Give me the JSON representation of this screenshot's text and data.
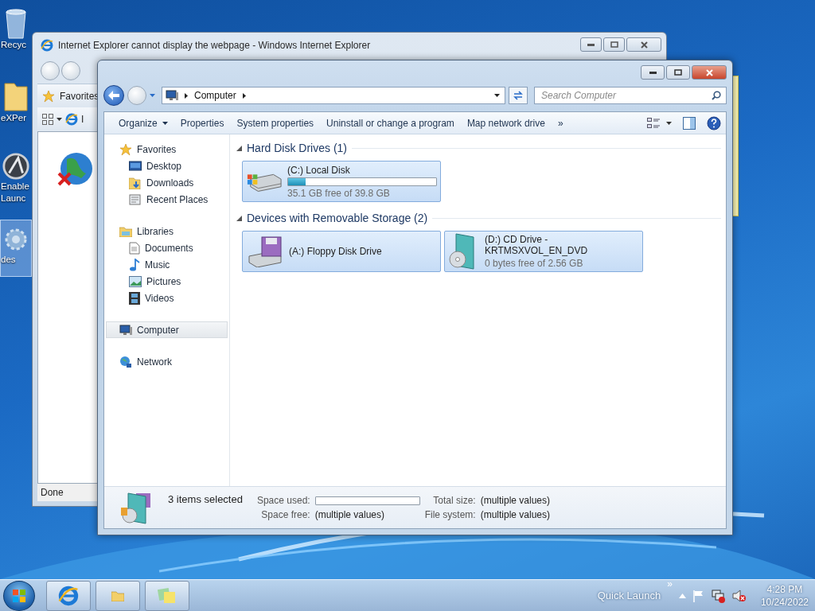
{
  "desktop_icons": [
    {
      "label": "Recyc",
      "selected": false
    },
    {
      "label": "eXPer",
      "selected": false
    },
    {
      "label": "Enable Launc",
      "selected": false
    },
    {
      "label": "des",
      "selected": true
    }
  ],
  "ie_window": {
    "title": "Internet Explorer cannot display the webpage - Windows Internet Explorer",
    "favorites": "Favorites",
    "tab": "I",
    "status": "Done"
  },
  "explorer": {
    "address": {
      "crumbs": [
        "Computer"
      ]
    },
    "search": {
      "placeholder": "Search Computer"
    },
    "commands": [
      {
        "label": "Organize",
        "kind": "menu"
      },
      {
        "label": "Properties",
        "kind": "action"
      },
      {
        "label": "System properties",
        "kind": "action"
      },
      {
        "label": "Uninstall or change a program",
        "kind": "action"
      },
      {
        "label": "Map network drive",
        "kind": "action"
      }
    ],
    "overflow": "»",
    "nav": [
      {
        "label": "Favorites",
        "selected": false,
        "children": [
          {
            "label": "Desktop",
            "selected": false
          },
          {
            "label": "Downloads",
            "selected": false
          },
          {
            "label": "Recent Places",
            "selected": false
          }
        ]
      },
      {
        "label": "Libraries",
        "selected": false,
        "children": [
          {
            "label": "Documents",
            "selected": false
          },
          {
            "label": "Music",
            "selected": false
          },
          {
            "label": "Pictures",
            "selected": false
          },
          {
            "label": "Videos",
            "selected": false
          }
        ]
      },
      {
        "label": "Computer",
        "selected": true
      },
      {
        "label": "Network",
        "selected": false
      }
    ],
    "sections": [
      {
        "title": "Hard Disk Drives (1)",
        "expanded": true,
        "drives": [
          {
            "kind": "hdd",
            "name": "(C:) Local Disk",
            "level": 0.12,
            "info": "35.1 GB free of 39.8 GB",
            "selected": true
          }
        ]
      },
      {
        "title": "Devices with Removable Storage (2)",
        "expanded": true,
        "drives": [
          {
            "kind": "floppy",
            "name": "(A:) Floppy Disk Drive",
            "selected": true
          },
          {
            "kind": "cd",
            "name": "(D:) CD Drive - KRTMSXVOL_EN_DVD",
            "info": "0 bytes free of 2.56 GB",
            "selected": true
          }
        ]
      }
    ],
    "details": {
      "summary": "3 items selected",
      "fields": [
        {
          "label": "Space used:",
          "kind": "bar",
          "level": 0
        },
        {
          "label": "Total size:",
          "kind": "text",
          "value": "(multiple values)"
        },
        {
          "label": "Space free:",
          "kind": "text",
          "value": "(multiple values)"
        },
        {
          "label": "File system:",
          "kind": "text",
          "value": "(multiple values)"
        }
      ]
    }
  },
  "taskbar": {
    "quick_launch": "Quick Launch",
    "chevron": "»",
    "time": "4:28 PM",
    "date": "10/24/2022"
  }
}
